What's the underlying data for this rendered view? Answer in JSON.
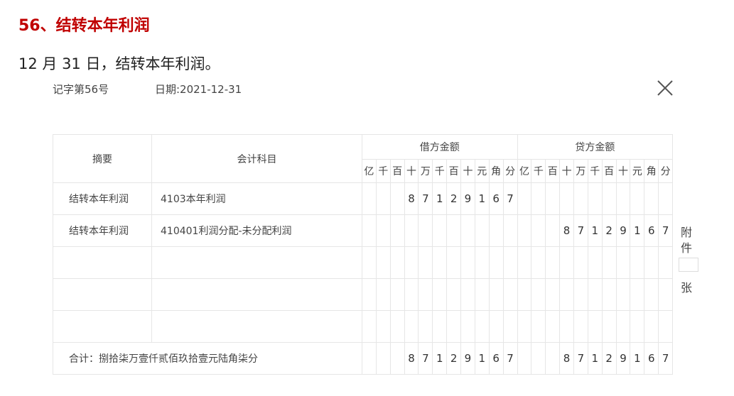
{
  "heading": "56、结转本年利润",
  "description": "12 月 31 日，结转本年利润。",
  "voucher": {
    "number": "记字第56号",
    "date": "日期:2021-12-31",
    "close_icon": "close-icon",
    "headers": {
      "summary": "摘要",
      "subject": "会计科目",
      "debit": "借方金额",
      "credit": "贷方金额",
      "units": [
        "亿",
        "千",
        "百",
        "十",
        "万",
        "千",
        "百",
        "十",
        "元",
        "角",
        "分"
      ]
    },
    "rows": [
      {
        "summary": "结转本年利润",
        "subject": "4103本年利润",
        "debit": [
          "",
          "",
          "",
          "8",
          "7",
          "1",
          "2",
          "9",
          "1",
          "6",
          "7"
        ],
        "credit": [
          "",
          "",
          "",
          "",
          "",
          "",
          "",
          "",
          "",
          "",
          ""
        ]
      },
      {
        "summary": "结转本年利润",
        "subject": "410401利润分配-未分配利润",
        "debit": [
          "",
          "",
          "",
          "",
          "",
          "",
          "",
          "",
          "",
          "",
          ""
        ],
        "credit": [
          "",
          "",
          "",
          "8",
          "7",
          "1",
          "2",
          "9",
          "1",
          "6",
          "7"
        ]
      },
      {
        "summary": "",
        "subject": "",
        "debit": [
          "",
          "",
          "",
          "",
          "",
          "",
          "",
          "",
          "",
          "",
          ""
        ],
        "credit": [
          "",
          "",
          "",
          "",
          "",
          "",
          "",
          "",
          "",
          "",
          ""
        ]
      },
      {
        "summary": "",
        "subject": "",
        "debit": [
          "",
          "",
          "",
          "",
          "",
          "",
          "",
          "",
          "",
          "",
          ""
        ],
        "credit": [
          "",
          "",
          "",
          "",
          "",
          "",
          "",
          "",
          "",
          "",
          ""
        ]
      },
      {
        "summary": "",
        "subject": "",
        "debit": [
          "",
          "",
          "",
          "",
          "",
          "",
          "",
          "",
          "",
          "",
          ""
        ],
        "credit": [
          "",
          "",
          "",
          "",
          "",
          "",
          "",
          "",
          "",
          "",
          ""
        ]
      }
    ],
    "total": {
      "label": "合计：捌拾柒万壹仟贰佰玖拾壹元陆角柒分",
      "debit": [
        "",
        "",
        "",
        "8",
        "7",
        "1",
        "2",
        "9",
        "1",
        "6",
        "7"
      ],
      "credit": [
        "",
        "",
        "",
        "8",
        "7",
        "1",
        "2",
        "9",
        "1",
        "6",
        "7"
      ]
    },
    "attachment": {
      "label_top": "附",
      "label_mid": "件",
      "count": "",
      "label_bottom": "张"
    }
  }
}
